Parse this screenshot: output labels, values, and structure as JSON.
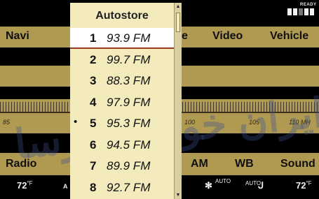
{
  "menu": {
    "navi": "Navi",
    "audio_partial": "e",
    "video": "Video",
    "vehicle": "Vehicle"
  },
  "status": {
    "ready": "READY"
  },
  "frequency_scale": {
    "t85": "85",
    "t100": "100",
    "t105": "105",
    "t110": "110 MH"
  },
  "bottom": {
    "radio": "Radio",
    "am": "AM",
    "wb": "WB",
    "sound": "Sound"
  },
  "climate": {
    "temp_left": "72",
    "temp_right": "72",
    "unit": "°F",
    "auto_left": "AUTO",
    "auto_right": "AUTO",
    "left_edge": "A"
  },
  "popup": {
    "title": "Autostore",
    "items": [
      {
        "num": "1",
        "freq": "93.9 FM",
        "bullet": ""
      },
      {
        "num": "2",
        "freq": "99.7 FM",
        "bullet": ""
      },
      {
        "num": "3",
        "freq": "88.3 FM",
        "bullet": ""
      },
      {
        "num": "4",
        "freq": "97.9 FM",
        "bullet": ""
      },
      {
        "num": "5",
        "freq": "95.3 FM",
        "bullet": "•"
      },
      {
        "num": "6",
        "freq": "94.5 FM",
        "bullet": ""
      },
      {
        "num": "7",
        "freq": "89.9 FM",
        "bullet": ""
      },
      {
        "num": "8",
        "freq": "92.7 FM",
        "bullet": ""
      }
    ],
    "selected_index": 0,
    "scroll_up": "▲",
    "scroll_down": "▼"
  },
  "watermark": "ایران خودرو فارسا"
}
